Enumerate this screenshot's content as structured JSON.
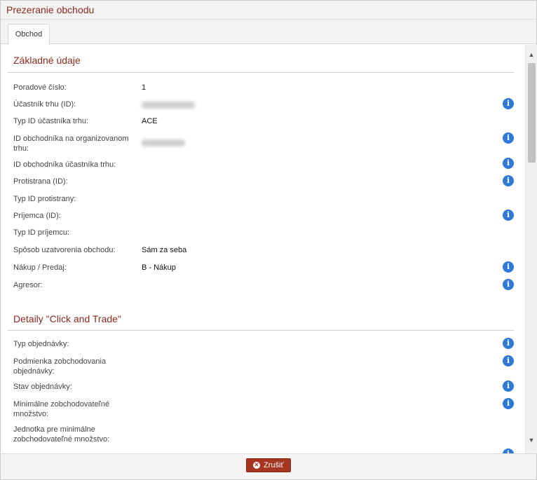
{
  "window": {
    "title": "Prezeranie obchodu"
  },
  "tabs": [
    {
      "label": "Obchod"
    }
  ],
  "sections": [
    {
      "title": "Základné údaje",
      "fields": [
        {
          "label": "Poradové číslo:",
          "value": "1",
          "info": false
        },
        {
          "label": "Účastník trhu (ID):",
          "value": "",
          "redacted": true,
          "info": true
        },
        {
          "label": "Typ ID účastníka trhu:",
          "value": "ACE",
          "info": false
        },
        {
          "label": "ID obchodníka na organizovanom trhu:",
          "value": "",
          "redacted": true,
          "info": true
        },
        {
          "label": "ID obchodníka účastníka trhu:",
          "value": "",
          "info": true
        },
        {
          "label": "Protistrana (ID):",
          "value": "",
          "info": true
        },
        {
          "label": "Typ ID protistrany:",
          "value": "",
          "info": false
        },
        {
          "label": "Príjemca (ID):",
          "value": "",
          "info": true
        },
        {
          "label": "Typ ID príjemcu:",
          "value": "",
          "info": false
        },
        {
          "label": "Spôsob uzatvorenia obchodu:",
          "value": "Sám za seba",
          "info": false
        },
        {
          "label": "Nákup / Predaj:",
          "value": "B - Nákup",
          "info": true
        },
        {
          "label": "Agresor:",
          "value": "",
          "info": true
        }
      ]
    },
    {
      "title": "Detaily \"Click and Trade\"",
      "fields": [
        {
          "label": "Typ objednávky:",
          "value": "",
          "info": true
        },
        {
          "label": "Podmienka zobchodovania objednávky:",
          "value": "",
          "info": true
        },
        {
          "label": "Stav objednávky:",
          "value": "",
          "info": true
        },
        {
          "label": "Minimálne zobchodovateľné množstvo:",
          "value": "",
          "info": true
        },
        {
          "label": "Jednotka pre minimálne zobchodovateľné množstvo:",
          "value": "",
          "info": false
        }
      ]
    }
  ],
  "icons": {
    "info": "info-icon",
    "cancel": "close-circle-icon",
    "scroll_up": "chevron-up-icon",
    "scroll_down": "chevron-down-icon"
  },
  "footer": {
    "cancel_label": "Zrušiť"
  },
  "colors": {
    "title": "#8a2a1a",
    "accent": "#a5351e",
    "info": "#2e78d8"
  }
}
